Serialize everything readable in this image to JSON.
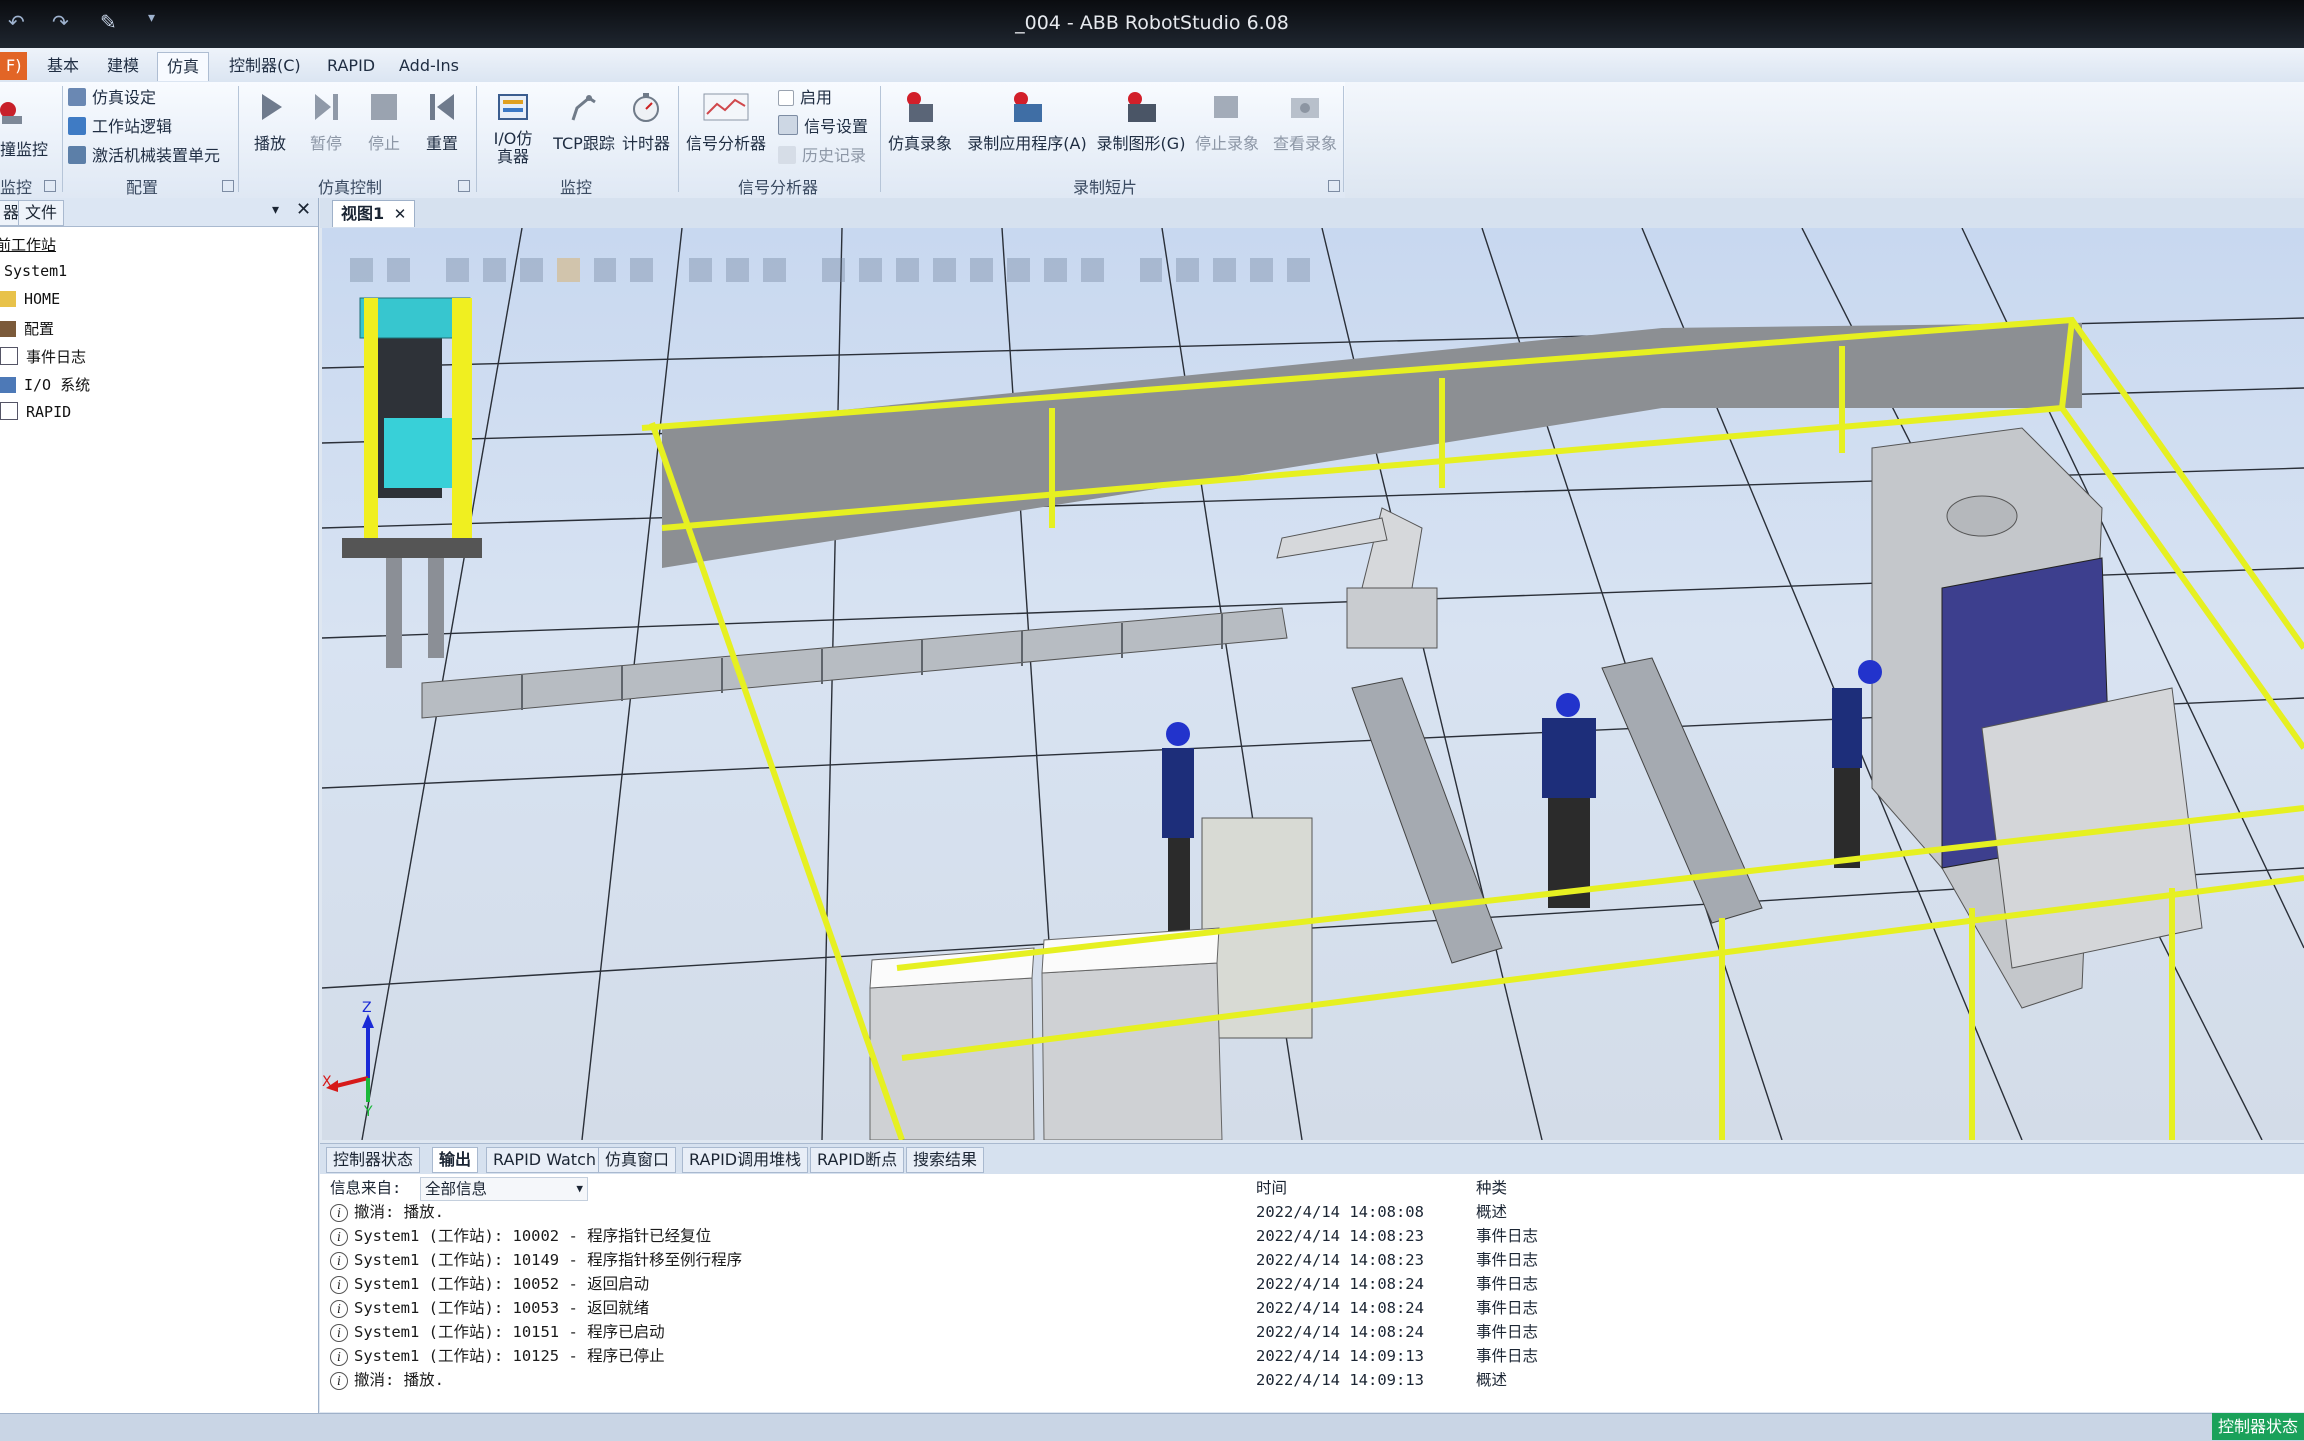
{
  "window": {
    "title": "_004 - ABB RobotStudio 6.08"
  },
  "ribbon_tabs": [
    {
      "label": "F)"
    },
    {
      "label": "基本"
    },
    {
      "label": "建模"
    },
    {
      "label": "仿真"
    },
    {
      "label": "控制器(C)"
    },
    {
      "label": "RAPID"
    },
    {
      "label": "Add-Ins"
    }
  ],
  "ribbon": {
    "collision": {
      "label": "撞监控",
      "group": "监控"
    },
    "config": {
      "items": [
        "仿真设定",
        "工作站逻辑",
        "激活机械装置单元"
      ],
      "group": "配置"
    },
    "sim_control": {
      "play": "播放",
      "pause": "暂停",
      "stop": "停止",
      "reset": "重置",
      "group": "仿真控制"
    },
    "monitor": {
      "io_sim": "I/O仿真器",
      "tcp": "TCP跟踪",
      "timer": "计时器",
      "group": "监控"
    },
    "signal": {
      "analyzer": "信号分析器",
      "enable": "启用",
      "settings": "信号设置",
      "history": "历史记录",
      "group": "信号分析器"
    },
    "record": {
      "sim_record": "仿真录象",
      "record_app": "录制应用程序(A)",
      "record_graphics": "录制图形(G)",
      "stop_record": "停止录象",
      "view_record": "查看录象",
      "group": "录制短片"
    }
  },
  "left_panel": {
    "tabs": [
      "器",
      "文件"
    ],
    "tree": [
      "前工作站",
      "System1",
      "HOME",
      "配置",
      "事件日志",
      "I/O 系统",
      "RAPID"
    ]
  },
  "document_tab": {
    "label": "视图1"
  },
  "axes": {
    "z": "Z",
    "x": "X",
    "y": "Y"
  },
  "output_tabs": [
    "控制器状态",
    "输出",
    "RAPID Watch",
    "仿真窗口",
    "RAPID调用堆栈",
    "RAPID断点",
    "搜索结果"
  ],
  "output": {
    "filter_label": "信息来自:",
    "filter_value": "全部信息",
    "col_time": "时间",
    "col_category": "种类",
    "rows": [
      {
        "msg": "撤消: 播放.",
        "time": "2022/4/14 14:08:08",
        "cat": "概述"
      },
      {
        "msg": "System1 (工作站): 10002 - 程序指针已经复位",
        "time": "2022/4/14 14:08:23",
        "cat": "事件日志"
      },
      {
        "msg": "System1 (工作站): 10149 - 程序指针移至例行程序",
        "time": "2022/4/14 14:08:23",
        "cat": "事件日志"
      },
      {
        "msg": "System1 (工作站): 10052 - 返回启动",
        "time": "2022/4/14 14:08:24",
        "cat": "事件日志"
      },
      {
        "msg": "System1 (工作站): 10053 - 返回就绪",
        "time": "2022/4/14 14:08:24",
        "cat": "事件日志"
      },
      {
        "msg": "System1 (工作站): 10151 - 程序已启动",
        "time": "2022/4/14 14:08:24",
        "cat": "事件日志"
      },
      {
        "msg": "System1 (工作站): 10125 - 程序已停止",
        "time": "2022/4/14 14:09:13",
        "cat": "事件日志"
      },
      {
        "msg": "撤消: 播放.",
        "time": "2022/4/14 14:09:13",
        "cat": "概述"
      }
    ]
  },
  "status": {
    "controller": "控制器状态"
  },
  "colors": {
    "file_tab": "#e26526",
    "fence": "#e6f021",
    "status_ok": "#1aa15a"
  }
}
